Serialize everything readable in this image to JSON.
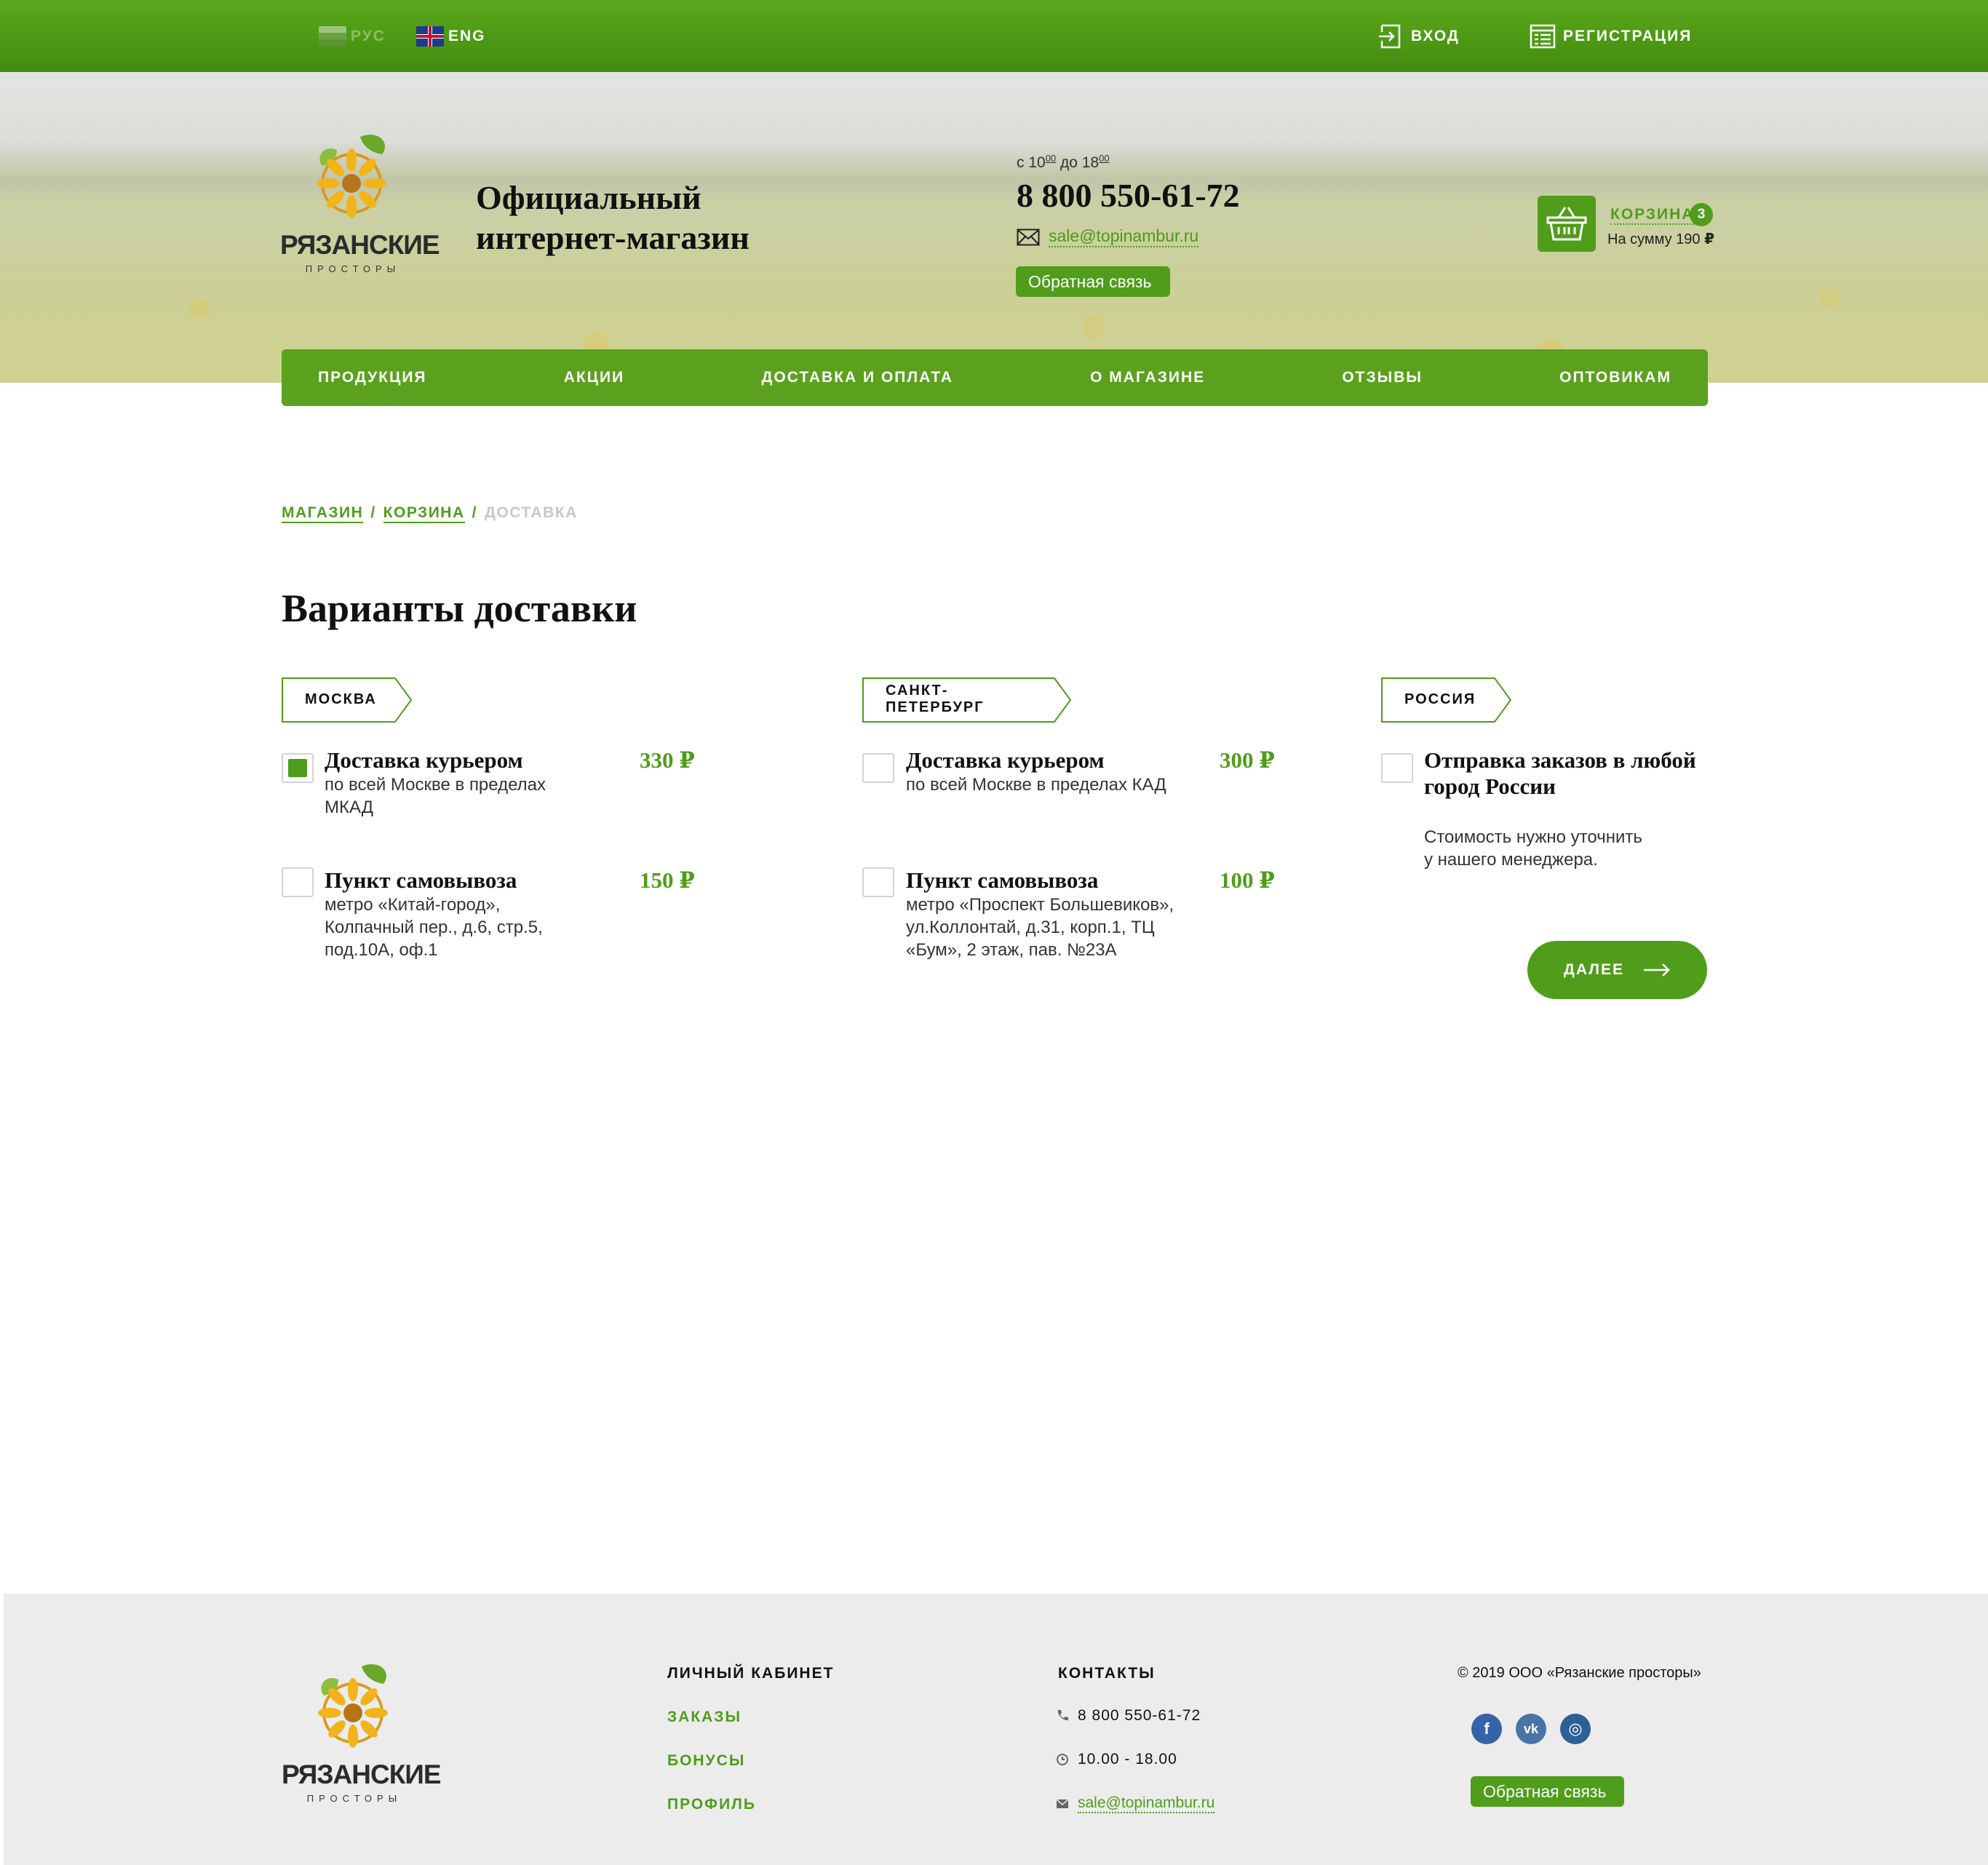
{
  "topbar": {
    "lang_ru": "РУС",
    "lang_en": "ENG",
    "login": "ВХОД",
    "register": "РЕГИСТРАЦИЯ"
  },
  "brand": {
    "name": "РЯЗАНСКИЕ",
    "sub": "ПРОСТОРЫ",
    "tagline_line1": "Официальный",
    "tagline_line2": "интернет-магазин"
  },
  "contact": {
    "hours_prefix": "с 10",
    "hours_sup1": "00",
    "hours_mid": " до 18",
    "hours_sup2": "00",
    "phone": "8 800 550-61-72",
    "email": "sale@topinambur.ru",
    "feedback": "Обратная связь"
  },
  "cart": {
    "label": "КОРЗИНА",
    "count": "3",
    "sum_text": "На сумму 190",
    "currency": "₽"
  },
  "nav": [
    "ПРОДУКЦИЯ",
    "АКЦИИ",
    "ДОСТАВКА И ОПЛАТА",
    "О МАГАЗИНЕ",
    "ОТЗЫВЫ",
    "ОПТОВИКАМ"
  ],
  "breadcrumb": {
    "shop": "МАГАЗИН",
    "cart": "КОРЗИНА",
    "current": "ДОСТАВКА",
    "sep": "/"
  },
  "page_title": "Варианты доставки",
  "regions": [
    {
      "name": "МОСКВА",
      "options": [
        {
          "title": "Доставка курьером",
          "desc": [
            "по всей Москве в пределах",
            "МКАД"
          ],
          "price": "330 ₽",
          "checked": true
        },
        {
          "title": "Пункт самовывоза",
          "desc": [
            "метро «Китай-город»,",
            "Колпачный пер., д.6, стр.5,",
            "под.10А, оф.1"
          ],
          "price": "150 ₽",
          "checked": false
        }
      ]
    },
    {
      "name": "САНКТ-ПЕТЕРБУРГ",
      "options": [
        {
          "title": "Доставка курьером",
          "desc": [
            "по всей Москве в пределах КАД"
          ],
          "price": "300 ₽",
          "checked": false
        },
        {
          "title": "Пункт самовывоза",
          "desc": [
            "метро «Проспект Большевиков»,",
            "ул.Коллонтай, д.31, корп.1, ТЦ",
            "«Бум», 2 этаж, пав. №23А"
          ],
          "price": "100 ₽",
          "checked": false
        }
      ]
    },
    {
      "name": "РОССИЯ",
      "options": [
        {
          "title_line1": "Отправка заказов в любой",
          "title_line2": "город России",
          "desc": [
            "Стоимость нужно уточнить",
            "у нашего менеджера."
          ],
          "checked": false
        }
      ]
    }
  ],
  "next_button": "ДАЛЕЕ",
  "footer": {
    "account_head": "ЛИЧНЫЙ КАБИНЕТ",
    "account_links": [
      "ЗАКАЗЫ",
      "БОНУСЫ",
      "ПРОФИЛЬ"
    ],
    "contacts_head": "КОНТАКТЫ",
    "phone": "8 800 550-61-72",
    "hours": "10.00 - 18.00",
    "email": "sale@topinambur.ru",
    "copyright": "© 2019 ООО «Рязанские просторы»",
    "social": [
      {
        "name": "facebook-icon",
        "glyph": "f",
        "color": "#3562a8"
      },
      {
        "name": "vk-icon",
        "glyph": "vk",
        "color": "#4a74a8"
      },
      {
        "name": "instagram-icon",
        "glyph": "◎",
        "color": "#2f5f97"
      }
    ],
    "feedback": "Обратная связь"
  },
  "colors": {
    "accent": "#4f9d1a",
    "topbar": "#4e9a15",
    "footer_bg": "#ececec"
  }
}
